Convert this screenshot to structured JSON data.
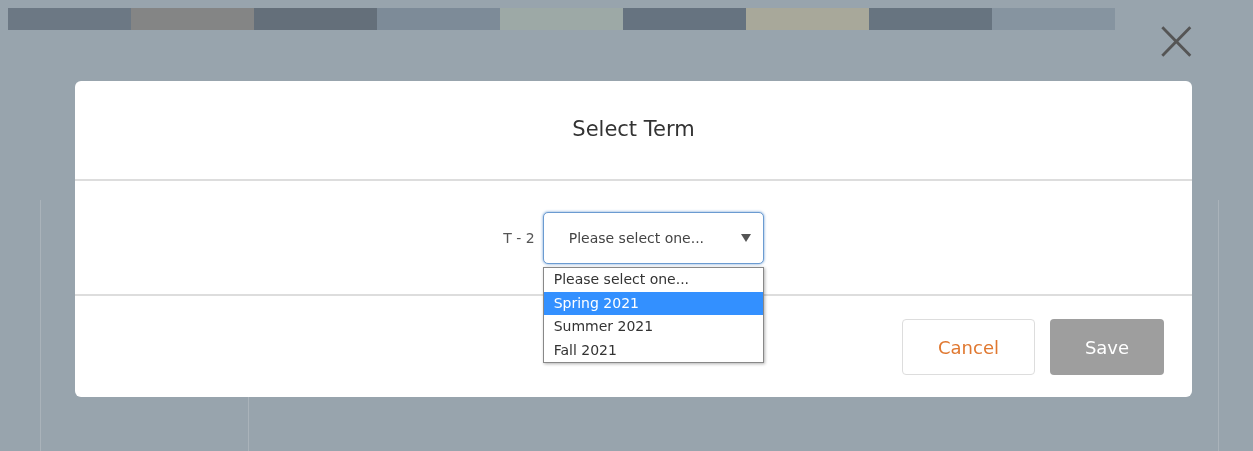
{
  "close_button": {
    "label": "×"
  },
  "dialog": {
    "title": "Select Term",
    "field": {
      "label": "T - 2",
      "value": "Please select one...",
      "expanded": true,
      "options": [
        {
          "label": "Please select one...",
          "highlighted": false
        },
        {
          "label": "Spring 2021",
          "highlighted": true
        },
        {
          "label": "Summer 2021",
          "highlighted": false
        },
        {
          "label": "Fall 2021",
          "highlighted": false
        }
      ]
    },
    "buttons": [
      {
        "label": "Cancel",
        "kind": "secondary",
        "disabled": false
      },
      {
        "label": "Save",
        "kind": "primary",
        "disabled": true
      }
    ]
  }
}
